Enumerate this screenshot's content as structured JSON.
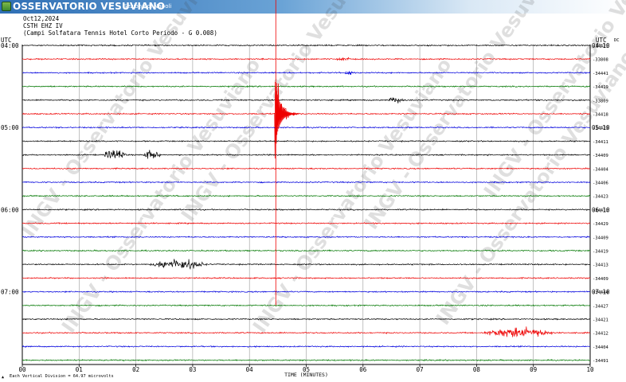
{
  "banner": {
    "title": "OSSERVATORIO VESUVIANO",
    "subtitle": "Sezione di Napoli"
  },
  "header": {
    "date": "Oct12,2024",
    "station": "CSTH EHZ IV",
    "description": "(Campi Solfatara Tennis Hotel Corto Periodo - G 0.008)"
  },
  "watermark": "INGV - Osservatorio Vesuviano",
  "colors": {
    "black": "#000000",
    "red": "#ee0000",
    "blue": "#0000dd",
    "green": "#007700",
    "grid": "#9a9a9a"
  },
  "chart_data": {
    "type": "line",
    "title": "",
    "xlabel": "TIME (MINUTES)",
    "ylabel_left": "UTC",
    "ylabel_right": "UTC",
    "right_header": "DC",
    "xlim": [
      0,
      10
    ],
    "x_ticks": [
      "00",
      "01",
      "02",
      "03",
      "04",
      "05",
      "06",
      "07",
      "08",
      "09",
      "10"
    ],
    "left_time_labels": [
      {
        "trace": 0,
        "label": "04:00"
      },
      {
        "trace": 6,
        "label": "05:00"
      },
      {
        "trace": 12,
        "label": "06:00"
      },
      {
        "trace": 18,
        "label": "07:00"
      }
    ],
    "right_time_labels": [
      {
        "trace": 0,
        "label": "04:10"
      },
      {
        "trace": 6,
        "label": "05:10"
      },
      {
        "trace": 12,
        "label": "06:10"
      },
      {
        "trace": 18,
        "label": "07:10"
      }
    ],
    "footer_note": "Each Vertical Division =     64.97 microvolts",
    "trace_interval_minutes": 10,
    "traces": [
      {
        "color": "black",
        "dc": "-34421",
        "events": []
      },
      {
        "color": "red",
        "dc": "-33808",
        "events": [
          {
            "x": 5.5,
            "width": 0.3,
            "amp": 2.5
          }
        ]
      },
      {
        "color": "blue",
        "dc": "-34441",
        "events": [
          {
            "x": 5.6,
            "width": 0.3,
            "amp": 2
          }
        ]
      },
      {
        "color": "green",
        "dc": "-34419",
        "events": []
      },
      {
        "color": "black",
        "dc": "-33809",
        "events": [
          {
            "x": 6.4,
            "width": 0.35,
            "amp": 3
          }
        ]
      },
      {
        "color": "red",
        "dc": "-34418",
        "events": [
          {
            "x": 4.45,
            "width": 0.45,
            "amp": 38
          }
        ]
      },
      {
        "color": "blue",
        "dc": "-34423",
        "events": []
      },
      {
        "color": "black",
        "dc": "-34411",
        "events": []
      },
      {
        "color": "black",
        "dc": "-34409",
        "events": [
          {
            "x": 1.4,
            "width": 0.45,
            "amp": 5
          },
          {
            "x": 2.1,
            "width": 0.35,
            "amp": 5
          }
        ]
      },
      {
        "color": "red",
        "dc": "-34404",
        "events": []
      },
      {
        "color": "blue",
        "dc": "-34406",
        "events": []
      },
      {
        "color": "green",
        "dc": "-34423",
        "events": []
      },
      {
        "color": "black",
        "dc": "-34411",
        "events": []
      },
      {
        "color": "red",
        "dc": "-34429",
        "events": []
      },
      {
        "color": "blue",
        "dc": "-34409",
        "events": []
      },
      {
        "color": "green",
        "dc": "-34419",
        "events": []
      },
      {
        "color": "black",
        "dc": "-34413",
        "events": [
          {
            "x": 2.2,
            "width": 1.1,
            "amp": 5
          }
        ]
      },
      {
        "color": "red",
        "dc": "-34409",
        "events": []
      },
      {
        "color": "blue",
        "dc": "-34444",
        "events": []
      },
      {
        "color": "green",
        "dc": "-34427",
        "events": []
      },
      {
        "color": "black",
        "dc": "-34421",
        "events": []
      },
      {
        "color": "red",
        "dc": "-34412",
        "events": [
          {
            "x": 8.05,
            "width": 1.4,
            "amp": 5
          }
        ]
      },
      {
        "color": "blue",
        "dc": "-34404",
        "events": []
      },
      {
        "color": "green",
        "dc": "-34491",
        "events": []
      }
    ],
    "main_event": {
      "x": 4.45,
      "start_trace": 0,
      "end_trace": 19
    }
  }
}
